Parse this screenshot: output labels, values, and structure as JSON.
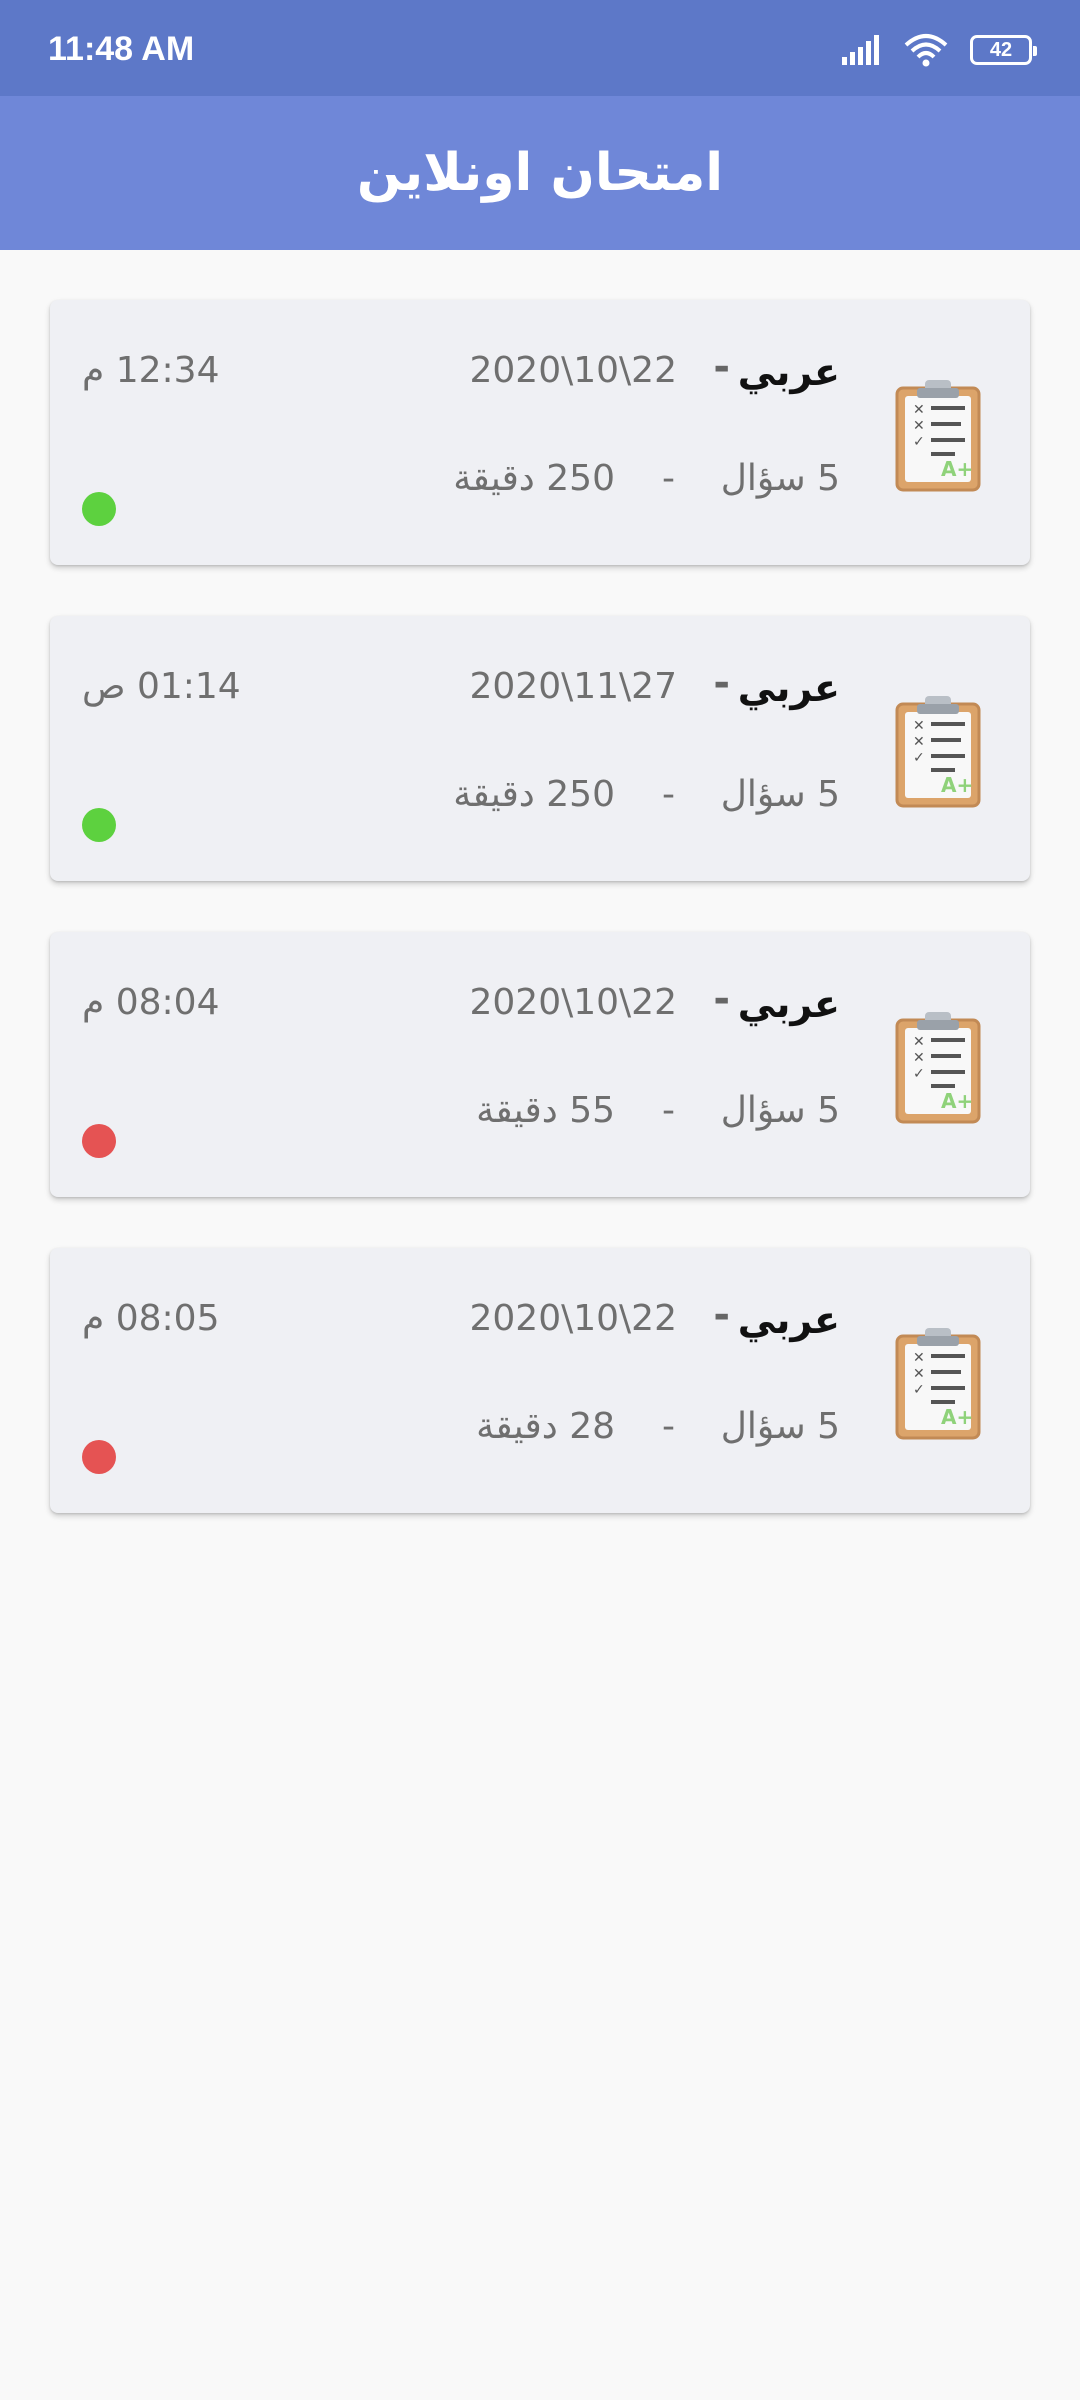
{
  "status_bar": {
    "time": "11:48 AM",
    "battery": "42"
  },
  "app_bar": {
    "title": "امتحان اونلاين"
  },
  "exams": [
    {
      "subject": "عربي",
      "separator": "-",
      "date": "2020\\10\\22",
      "time": "12:34 م",
      "questions": "5 سؤال",
      "separator2": "-",
      "duration": "250 دقيقة",
      "status_color": "#5dd13f",
      "icon": "clipboard-icon"
    },
    {
      "subject": "عربي",
      "separator": "-",
      "date": "2020\\11\\27",
      "time": "01:14 ص",
      "questions": "5 سؤال",
      "separator2": "-",
      "duration": "250 دقيقة",
      "status_color": "#5dd13f",
      "icon": "clipboard-icon"
    },
    {
      "subject": "عربي",
      "separator": "-",
      "date": "2020\\10\\22",
      "time": "08:04 م",
      "questions": "5 سؤال",
      "separator2": "-",
      "duration": "55 دقيقة",
      "status_color": "#e55353",
      "icon": "clipboard-icon"
    },
    {
      "subject": "عربي",
      "separator": "-",
      "date": "2020\\10\\22",
      "time": "08:05 م",
      "questions": "5 سؤال",
      "separator2": "-",
      "duration": "28 دقيقة",
      "status_color": "#e55353",
      "icon": "clipboard-icon"
    }
  ],
  "colors": {
    "status_bar": "#5d78c8",
    "app_bar": "#6f87d8",
    "card": "#eff0f4",
    "active": "#5dd13f",
    "inactive": "#e55353"
  }
}
